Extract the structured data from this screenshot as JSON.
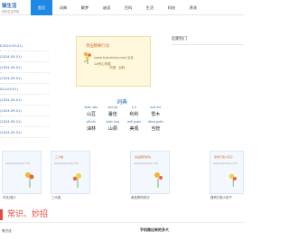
{
  "header": {
    "logo_title": "猫生活",
    "logo_sub": "好好生活不易",
    "nav": [
      "首页",
      "词典",
      "解梦",
      "谜语",
      "百科",
      "生活",
      "科技",
      "养花"
    ],
    "active_index": 0
  },
  "left_list": [
    "f(2024-09-01)",
    "(2024-09-01)",
    "(2024-09-01)",
    "(2024-09-01)",
    "024-09-01)",
    "(2024-09-01)",
    "(2024-09-01)",
    "(2024-09-01)",
    "(2024-09-01)"
  ],
  "card": {
    "title": "李田精事行动",
    "line1": "(www.liujinsheng.com) 出自",
    "line2": "1#的心然感",
    "buttons": [
      "词语",
      "百科"
    ]
  },
  "hot": {
    "title": "近期热门"
  },
  "vocab": {
    "head": "词典",
    "rows": [
      [
        {
          "py": "shān dòu",
          "word": "山豆"
        },
        {
          "py": "shǔ jiā",
          "word": "署佳"
        },
        {
          "py": "lì lì",
          "word": "利利"
        },
        {
          "py": "xuě mù",
          "word": "雪木"
        }
      ],
      [
        {
          "py": "yǒu lìn",
          "word": "油林"
        },
        {
          "py": "shān jǐng",
          "word": "山颈"
        },
        {
          "py": "měi guǎn",
          "word": "美观"
        },
        {
          "py": "dāng guǎn",
          "word": "当管"
        }
      ]
    ]
  },
  "thumbs": [
    {
      "head": "",
      "caption": "鸟花(猫)?",
      "txt": "(www.liujinsheng.com)"
    },
    {
      "head": "三大猫",
      "caption": "三大猫",
      "txt": "(www.liujinsheng.com)"
    },
    {
      "head": "食品群药成功",
      "caption": "食品群药成功",
      "txt": "(www.liujinsheng.com)"
    },
    {
      "head": "建筑打造小孩子",
      "caption": "建筑打造小孩子",
      "txt": "(www.liujinsheng.com)"
    }
  ],
  "section": {
    "title": "常识、妙招"
  },
  "bottom": {
    "left": "有方法",
    "right": "手机做出来的多大"
  }
}
